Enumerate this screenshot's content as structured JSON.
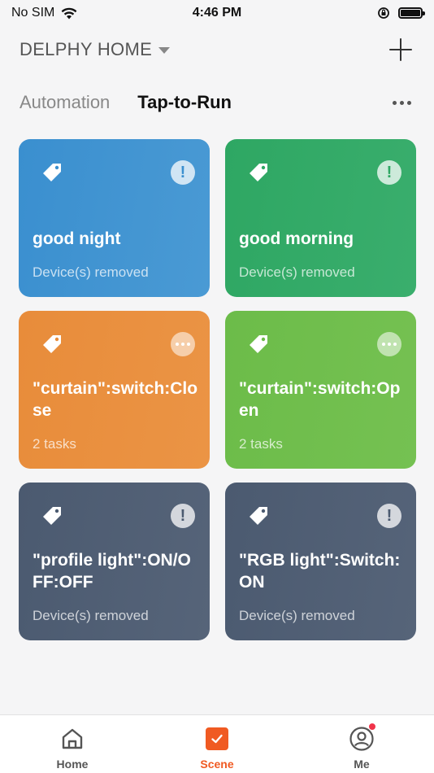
{
  "status_bar": {
    "carrier": "No SIM",
    "time": "4:46 PM"
  },
  "header": {
    "home_name": "DELPHY HOME"
  },
  "tabs": [
    {
      "label": "Automation",
      "active": false
    },
    {
      "label": "Tap-to-Run",
      "active": true
    }
  ],
  "scenes": [
    {
      "name": "good night",
      "subtitle": "Device(s) removed",
      "color": "#3a8fcf",
      "status_icon": "exclamation-icon"
    },
    {
      "name": "good morning",
      "subtitle": "Device(s) removed",
      "color": "#2ea763",
      "status_icon": "exclamation-icon"
    },
    {
      "name": "\"curtain\":switch:Close",
      "subtitle": "2 tasks",
      "color": "#e88c3a",
      "status_icon": "ellipsis-icon"
    },
    {
      "name": "\"curtain\":switch:Open",
      "subtitle": "2 tasks",
      "color": "#6cbc49",
      "status_icon": "ellipsis-icon"
    },
    {
      "name": "\"profile light\":ON/OFF:OFF",
      "subtitle": "Device(s) removed",
      "color": "#4b5a70",
      "status_icon": "exclamation-icon"
    },
    {
      "name": "\"RGB light\":Switch:ON",
      "subtitle": "Device(s) removed",
      "color": "#4b5a70",
      "status_icon": "exclamation-icon"
    }
  ],
  "bottom_nav": [
    {
      "label": "Home",
      "icon": "home-icon",
      "active": false
    },
    {
      "label": "Scene",
      "icon": "scene-icon",
      "active": true
    },
    {
      "label": "Me",
      "icon": "profile-icon",
      "active": false
    }
  ],
  "colors": {
    "accent": "#f05a22",
    "notification_badge": "#f0334a"
  }
}
